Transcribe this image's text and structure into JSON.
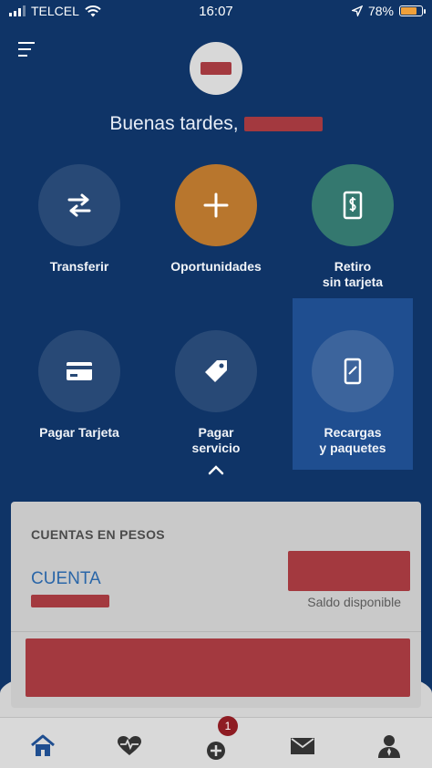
{
  "status_bar": {
    "carrier": "TELCEL",
    "time": "16:07",
    "battery": "78%",
    "battery_level": 0.78
  },
  "header": {
    "greeting": "Buenas tardes,"
  },
  "actions": [
    {
      "label": "Transferir",
      "icon": "transfer-arrows-icon"
    },
    {
      "label": "Oportunidades",
      "icon": "plus-icon"
    },
    {
      "label": "Retiro\nsin tarjeta",
      "icon": "phone-dollar-icon"
    },
    {
      "label": "Pagar Tarjeta",
      "icon": "card-icon"
    },
    {
      "label": "Pagar\nservicio",
      "icon": "tag-icon"
    },
    {
      "label": "Recargas\ny paquetes",
      "icon": "mobile-phone-icon",
      "selected": true
    }
  ],
  "accounts_card": {
    "title": "CUENTAS EN PESOS",
    "account_name": "CUENTA",
    "balance_label": "Saldo disponible"
  },
  "bottom_nav": {
    "items": [
      "home-icon",
      "health-icon",
      "add-icon",
      "mail-icon",
      "profile-icon"
    ],
    "badge": "1"
  },
  "colors": {
    "background": "#0f3467",
    "accent_orange": "#b8762d",
    "accent_teal": "#34786f",
    "account_blue": "#2a66a8",
    "badge_red": "#8e1c23"
  }
}
